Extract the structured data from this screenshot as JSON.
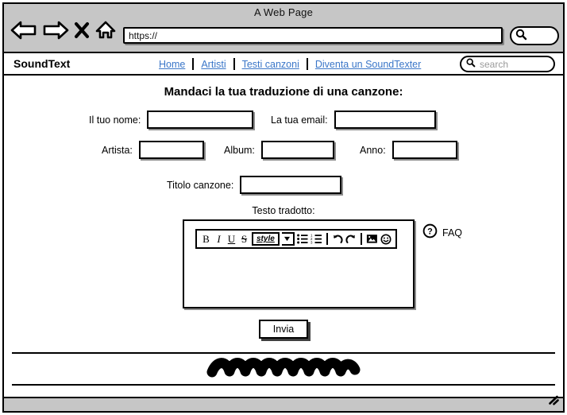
{
  "browser": {
    "window_title": "A Web Page",
    "url_value": "https://",
    "url_placeholder": "https://",
    "toolbar_icons": [
      "back-arrow-icon",
      "forward-arrow-icon",
      "stop-x-icon",
      "home-icon"
    ],
    "search_icon": "magnifier-icon"
  },
  "site_header": {
    "brand": "SoundText",
    "nav": [
      {
        "label": "Home"
      },
      {
        "label": "Artisti"
      },
      {
        "label": "Testi canzoni"
      },
      {
        "label": "Diventa un SoundTexter"
      }
    ],
    "search": {
      "placeholder": "search",
      "value": "",
      "icon": "magnifier-icon"
    },
    "link_color": "#3a76c8"
  },
  "form": {
    "title": "Mandaci la tua traduzione di una canzone:",
    "fields": [
      {
        "label": "Il tuo nome:",
        "value": ""
      },
      {
        "label": "La tua email:",
        "value": ""
      },
      {
        "label": "Artista:",
        "value": ""
      },
      {
        "label": "Album:",
        "value": ""
      },
      {
        "label": "Anno:",
        "value": ""
      },
      {
        "label": "Titolo canzone:",
        "value": ""
      }
    ],
    "editor": {
      "label": "Testo tradotto:",
      "value": "",
      "toolbar": [
        {
          "name": "bold-icon",
          "label": "B"
        },
        {
          "name": "italic-icon",
          "label": "I"
        },
        {
          "name": "underline-icon",
          "label": "U"
        },
        {
          "name": "strikethrough-icon",
          "label": "S"
        },
        {
          "name": "style-dropdown",
          "label": "style"
        },
        {
          "name": "bulleted-list-icon",
          "label": ""
        },
        {
          "name": "numbered-list-icon",
          "label": ""
        },
        {
          "name": "undo-icon",
          "label": ""
        },
        {
          "name": "redo-icon",
          "label": ""
        },
        {
          "name": "image-icon",
          "label": ""
        },
        {
          "name": "emoji-icon",
          "label": ""
        }
      ]
    },
    "faq": {
      "label": "FAQ",
      "icon": "question-mark-circle-icon"
    },
    "submit_label": "Invia"
  },
  "footer": {
    "scribble": "scribble-placeholder"
  },
  "status_bar": {
    "resize_grip": "resize-grip-icon"
  },
  "colors": {
    "chrome": "#c6c6c6",
    "link": "#3a76c8",
    "placeholder": "#9a9a9a",
    "outline": "#000000"
  }
}
